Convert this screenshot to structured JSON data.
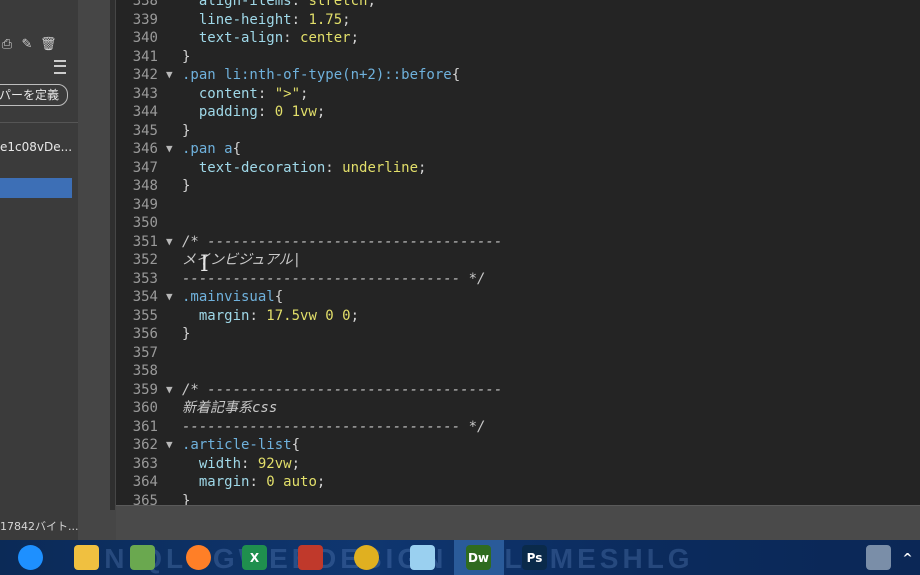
{
  "left_panel": {
    "define_button": "パーを定義",
    "file_item": "e1c08vDe...",
    "file_size": "17842バイト..."
  },
  "code_lines": [
    {
      "n": "338",
      "fold": "",
      "segs": [
        [
          "prop",
          "  align-items"
        ],
        [
          "punc",
          ": "
        ],
        [
          "val",
          "stretch"
        ],
        [
          "punc",
          ";"
        ]
      ]
    },
    {
      "n": "339",
      "fold": "",
      "segs": [
        [
          "prop",
          "  line-height"
        ],
        [
          "punc",
          ": "
        ],
        [
          "val",
          "1.75"
        ],
        [
          "punc",
          ";"
        ]
      ]
    },
    {
      "n": "340",
      "fold": "",
      "segs": [
        [
          "prop",
          "  text-align"
        ],
        [
          "punc",
          ": "
        ],
        [
          "val",
          "center"
        ],
        [
          "punc",
          ";"
        ]
      ]
    },
    {
      "n": "341",
      "fold": "",
      "segs": [
        [
          "punc",
          "}"
        ]
      ]
    },
    {
      "n": "342",
      "fold": "▼",
      "segs": [
        [
          "sel",
          ".pan li:nth-of-type(n+2)::before"
        ],
        [
          "punc",
          "{"
        ]
      ]
    },
    {
      "n": "343",
      "fold": "",
      "segs": [
        [
          "prop",
          "  content"
        ],
        [
          "punc",
          ": "
        ],
        [
          "val",
          "\">\""
        ],
        [
          "punc",
          ";"
        ]
      ]
    },
    {
      "n": "344",
      "fold": "",
      "segs": [
        [
          "prop",
          "  padding"
        ],
        [
          "punc",
          ": "
        ],
        [
          "val",
          "0 1vw"
        ],
        [
          "punc",
          ";"
        ]
      ]
    },
    {
      "n": "345",
      "fold": "",
      "segs": [
        [
          "punc",
          "}"
        ]
      ]
    },
    {
      "n": "346",
      "fold": "▼",
      "segs": [
        [
          "sel",
          ".pan a"
        ],
        [
          "punc",
          "{"
        ]
      ]
    },
    {
      "n": "347",
      "fold": "",
      "segs": [
        [
          "prop",
          "  text-decoration"
        ],
        [
          "punc",
          ": "
        ],
        [
          "val",
          "underline"
        ],
        [
          "punc",
          ";"
        ]
      ]
    },
    {
      "n": "348",
      "fold": "",
      "segs": [
        [
          "punc",
          "}"
        ]
      ]
    },
    {
      "n": "349",
      "fold": "",
      "segs": []
    },
    {
      "n": "350",
      "fold": "",
      "segs": []
    },
    {
      "n": "351",
      "fold": "▼",
      "segs": [
        [
          "comment",
          "/* -----------------------------------"
        ]
      ]
    },
    {
      "n": "352",
      "fold": "",
      "segs": [
        [
          "comment",
          "メインビジュアル|"
        ]
      ]
    },
    {
      "n": "353",
      "fold": "",
      "segs": [
        [
          "comment",
          "--------------------------------- */"
        ]
      ]
    },
    {
      "n": "354",
      "fold": "▼",
      "segs": [
        [
          "sel",
          ".mainvisual"
        ],
        [
          "punc",
          "{"
        ]
      ]
    },
    {
      "n": "355",
      "fold": "",
      "segs": [
        [
          "prop",
          "  margin"
        ],
        [
          "punc",
          ": "
        ],
        [
          "val",
          "17.5vw 0 0"
        ],
        [
          "punc",
          ";"
        ]
      ]
    },
    {
      "n": "356",
      "fold": "",
      "segs": [
        [
          "punc",
          "}"
        ]
      ]
    },
    {
      "n": "357",
      "fold": "",
      "segs": []
    },
    {
      "n": "358",
      "fold": "",
      "segs": []
    },
    {
      "n": "359",
      "fold": "▼",
      "segs": [
        [
          "comment",
          "/* -----------------------------------"
        ]
      ]
    },
    {
      "n": "360",
      "fold": "",
      "segs": [
        [
          "comment",
          "新着記事系css"
        ]
      ]
    },
    {
      "n": "361",
      "fold": "",
      "segs": [
        [
          "comment",
          "--------------------------------- */"
        ]
      ]
    },
    {
      "n": "362",
      "fold": "▼",
      "segs": [
        [
          "sel",
          ".article-list"
        ],
        [
          "punc",
          "{"
        ]
      ]
    },
    {
      "n": "363",
      "fold": "",
      "segs": [
        [
          "prop",
          "  width"
        ],
        [
          "punc",
          ": "
        ],
        [
          "val",
          "92vw"
        ],
        [
          "punc",
          ";"
        ]
      ]
    },
    {
      "n": "364",
      "fold": "",
      "segs": [
        [
          "prop",
          "  margin"
        ],
        [
          "punc",
          ": "
        ],
        [
          "val",
          "0 auto"
        ],
        [
          "punc",
          ";"
        ]
      ]
    },
    {
      "n": "365",
      "fold": "",
      "segs": [
        [
          "punc",
          "}"
        ]
      ]
    }
  ],
  "taskbar": {
    "watermark": "UNIQLOGWEBDESIGN EPLUMESHLG",
    "apps": [
      {
        "name": "start-icon",
        "label": "",
        "color": "#1e90ff"
      },
      {
        "name": "file-explorer-icon",
        "label": "",
        "color": "#f0c040"
      },
      {
        "name": "evernote-icon",
        "label": "",
        "color": "#6aa84f"
      },
      {
        "name": "firefox-icon",
        "label": "",
        "color": "#ff7f27"
      },
      {
        "name": "excel-icon",
        "label": "X",
        "color": "#1f8f4e"
      },
      {
        "name": "photos-icon",
        "label": "",
        "color": "#c0392b"
      },
      {
        "name": "chrome-icon",
        "label": "",
        "color": "#e0b020"
      },
      {
        "name": "notes-icon",
        "label": "",
        "color": "#9ad0f0"
      },
      {
        "name": "dreamweaver-icon",
        "label": "Dw",
        "color": "#2f6b1f"
      },
      {
        "name": "photoshop-icon",
        "label": "Ps",
        "color": "#0a2a4a"
      },
      {
        "name": "settings-icon",
        "label": "",
        "color": "#7a8ea8"
      }
    ],
    "tray_chevron": "^"
  }
}
